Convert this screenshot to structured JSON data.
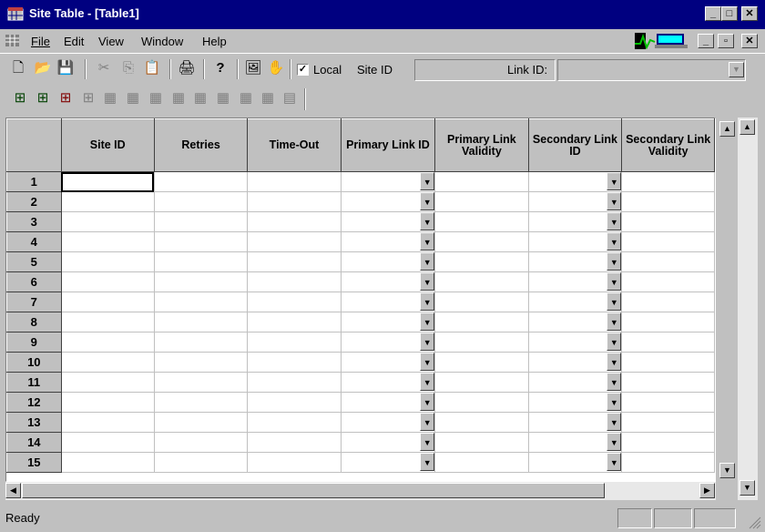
{
  "window": {
    "title": "Site Table - [Table1]"
  },
  "menu": [
    {
      "label": "File"
    },
    {
      "label": "Edit"
    },
    {
      "label": "View"
    },
    {
      "label": "Window"
    },
    {
      "label": "Help"
    }
  ],
  "toolbar": {
    "local_checkbox": {
      "label": "Local",
      "checked": true
    },
    "site_id_label": "Site ID",
    "site_id_value": "",
    "link_id_label": "Link ID:",
    "link_id_value": ""
  },
  "grid": {
    "columns": [
      "Site ID",
      "Retries",
      "Time-Out",
      "Primary Link ID",
      "Primary Link Validity",
      "Secondary Link ID",
      "Secondary Link Validity"
    ],
    "row_numbers": [
      "1",
      "2",
      "3",
      "4",
      "5",
      "6",
      "7",
      "8",
      "9",
      "10",
      "11",
      "12",
      "13",
      "14",
      "15"
    ],
    "selected_cell": "Site ID row 1"
  },
  "status": {
    "text": "Ready"
  },
  "colors": {
    "titlebar": "#000080",
    "face": "#c0c0c0"
  }
}
